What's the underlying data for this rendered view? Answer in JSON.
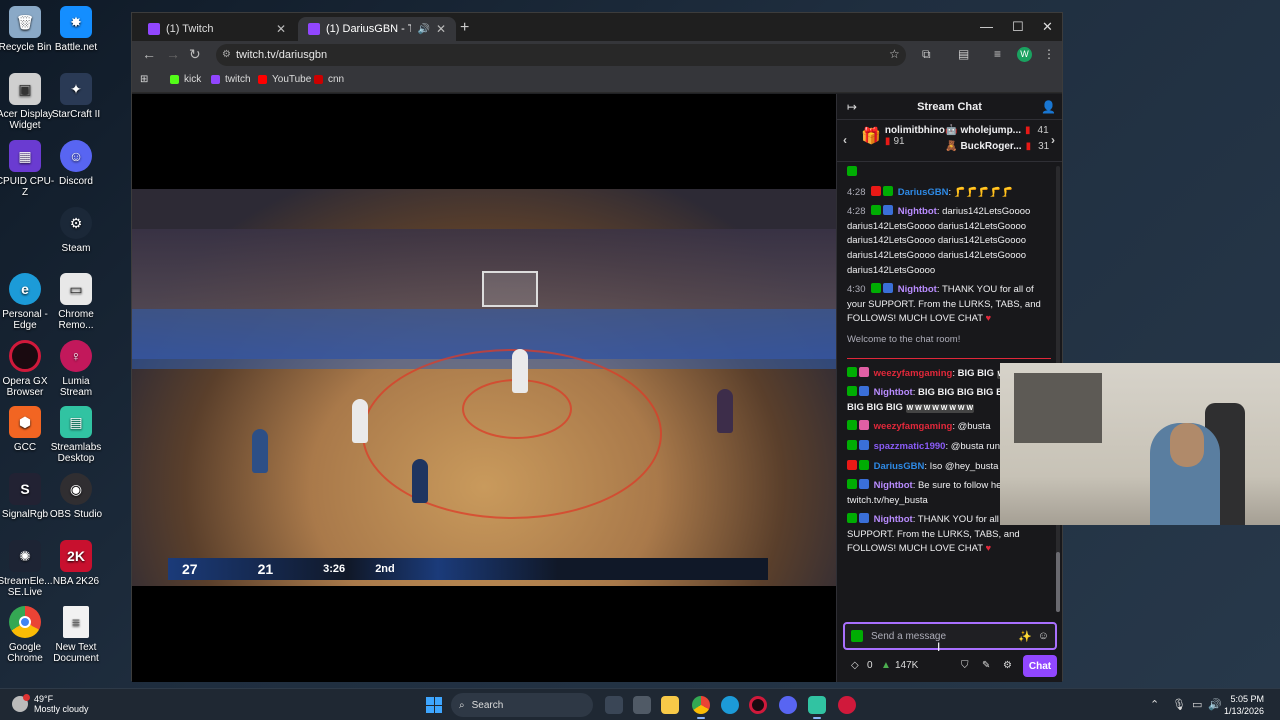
{
  "desktop": {
    "icons": [
      {
        "label": "Recycle Bin",
        "icon": "recycle-bin-icon",
        "color": "#8aa9c7"
      },
      {
        "label": "Battle.net",
        "icon": "battlenet-icon",
        "color": "#148eff"
      },
      {
        "label": "Acer Display Widget",
        "icon": "acer-display-icon",
        "color": "#cfcfcf"
      },
      {
        "label": "StarCraft II",
        "icon": "starcraft-icon",
        "color": "#2a3a55"
      },
      {
        "label": "CPUID CPU-Z",
        "icon": "cpuz-icon",
        "color": "#6a3bd1"
      },
      {
        "label": "Discord",
        "icon": "discord-icon",
        "color": "#5865f2"
      },
      {
        "label": "Steam",
        "icon": "steam-icon",
        "color": "#1b2838"
      },
      {
        "label": "Personal - Edge",
        "icon": "edge-icon",
        "color": "#1c9bd8"
      },
      {
        "label": "Chrome Remo...",
        "icon": "chrome-remote-icon",
        "color": "#e8e8e8"
      },
      {
        "label": "Opera GX Browser",
        "icon": "opera-gx-icon",
        "color": "#d0193b"
      },
      {
        "label": "Lumia Stream",
        "icon": "lumia-stream-icon",
        "color": "#c2185b"
      },
      {
        "label": "GCC",
        "icon": "gcc-icon",
        "color": "#f26522"
      },
      {
        "label": "Streamlabs Desktop",
        "icon": "streamlabs-icon",
        "color": "#31c3a2"
      },
      {
        "label": "SignalRgb",
        "icon": "signalrgb-icon",
        "color": "#222233"
      },
      {
        "label": "OBS Studio",
        "icon": "obs-icon",
        "color": "#302e31"
      },
      {
        "label": "StreamEle... SE.Live",
        "icon": "streamelements-icon",
        "color": "#1d2434"
      },
      {
        "label": "NBA 2K26",
        "icon": "nba2k-icon",
        "color": "#c8102e"
      },
      {
        "label": "Google Chrome",
        "icon": "chrome-icon",
        "color": "#4285f4"
      },
      {
        "label": "New Text Document",
        "icon": "text-document-icon",
        "color": "#f2f2f2"
      }
    ]
  },
  "browser": {
    "tabs": [
      {
        "title": "(1) Twitch",
        "active": false
      },
      {
        "title": "(1) DariusGBN - Twitch",
        "active": true
      }
    ],
    "url": "twitch.tv/dariusgbn",
    "profile_initial": "W",
    "bookmarks": [
      {
        "label": "kick",
        "color": "#53fc18"
      },
      {
        "label": "twitch",
        "color": "#9146ff"
      },
      {
        "label": "YouTube",
        "color": "#ff0000"
      },
      {
        "label": "cnn",
        "color": "#cc0000"
      }
    ]
  },
  "video": {
    "score_home": "27",
    "score_away": "21",
    "game_clock": "3:26",
    "quarter": "2nd"
  },
  "chat": {
    "title": "Stream Chat",
    "gifters": [
      {
        "name": "nolimitbhino",
        "count": "91"
      },
      {
        "name": "wholejump...",
        "count": "41"
      },
      {
        "name": "BuckRoger...",
        "count": "31"
      }
    ],
    "messages": [
      {
        "ts": "4:28",
        "user": "DariusGBN",
        "text": "🦵🦵🦵🦵🦵"
      },
      {
        "ts": "4:28",
        "user": "Nightbot",
        "text": "darius142LetsGoooo darius142LetsGoooo darius142LetsGoooo darius142LetsGoooo darius142LetsGoooo darius142LetsGoooo darius142LetsGoooo darius142LetsGoooo"
      },
      {
        "ts": "4:30",
        "user": "Nightbot",
        "text": "THANK YOU for all of your SUPPORT. From the LURKS, TABS, and FOLLOWS! MUCH LOVE CHAT"
      }
    ],
    "welcome": "Welcome to the chat room!",
    "recent": [
      {
        "user": "weezyfamgaming",
        "text": "BIG BIG",
        "emote": "W W"
      },
      {
        "user": "Nightbot",
        "text": "BIG BIG BIG BIG BIG BIG BIG BIG BIG",
        "emote": "W W W W W W W W"
      },
      {
        "user": "weezyfamgaming",
        "text": "@busta"
      },
      {
        "user": "spazzmatic1990",
        "text": "@busta runs"
      },
      {
        "user": "DariusGBN",
        "text": "Iso @hey_busta"
      },
      {
        "user": "Nightbot",
        "text": "Be sure to follow hey_busta at twitch.tv/hey_busta"
      },
      {
        "user": "Nightbot",
        "text": "THANK YOU for all of your SUPPORT. From the LURKS, TABS, and FOLLOWS! MUCH LOVE CHAT"
      }
    ],
    "input_placeholder": "Send a message",
    "points": "0",
    "bits": "147K",
    "chat_button": "Chat"
  },
  "taskbar": {
    "temperature": "49°F",
    "weather": "Mostly cloudy",
    "search_placeholder": "Search",
    "time": "5:05 PM",
    "date": "1/13/2026"
  }
}
